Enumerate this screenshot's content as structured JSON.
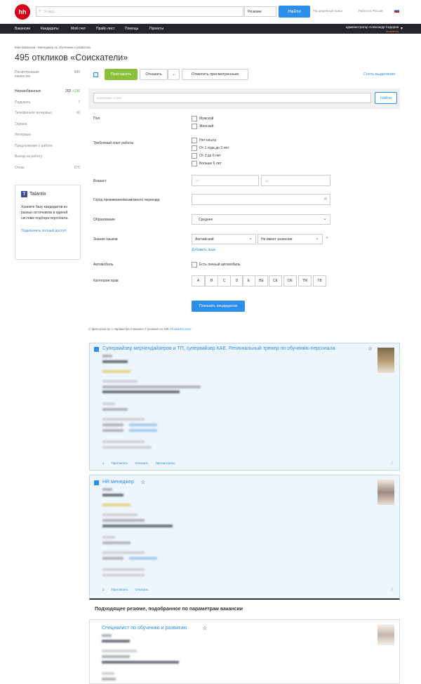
{
  "header": {
    "logo": "hh",
    "search_placeholder": "Я ищу...",
    "search_type": "Резюме",
    "find_label": "Найти",
    "advanced_search": "Расширенный поиск",
    "work_in_russia": "Работа в России"
  },
  "nav": {
    "items": [
      "Вакансии",
      "Кандидаты",
      "Мой счет",
      "Прайс-лист",
      "Помощь",
      "Проекты"
    ],
    "user": "администратор Александр Сидоров",
    "user_sub": "Компания"
  },
  "breadcrumb": "Мои вакансии › Менеджер по обучению и развитию",
  "page_title": "495 откликов «Соискатели»",
  "sidebar": {
    "items": [
      {
        "label": "Посмотревшие вакансию",
        "count": "999",
        "extra": ""
      },
      {
        "label": "Неразобранные",
        "count": "202",
        "extra": "+136"
      },
      {
        "label": "Подумать",
        "count": "7",
        "extra": ""
      },
      {
        "label": "Телефонное интервью",
        "count": "10",
        "extra": ""
      },
      {
        "label": "Оценка",
        "count": "",
        "extra": ""
      },
      {
        "label": "Интервью",
        "count": "",
        "extra": ""
      },
      {
        "label": "Предложение о работе",
        "count": "",
        "extra": ""
      },
      {
        "label": "Выход на работу",
        "count": "",
        "extra": ""
      },
      {
        "label": "Отказ",
        "count": "270",
        "extra": ""
      }
    ]
  },
  "talantix": {
    "name": "Talantix",
    "text": "Храните базу кандидатов из разных источников в единой системе подбора персонала.",
    "link": "Подключить полный доступ"
  },
  "toolbar": {
    "invite": "Пригласить",
    "reject": "Отказать",
    "mark_viewed": "Отметить просмотренным",
    "deselect": "Снять выделение"
  },
  "filters": {
    "keywords_placeholder": "Ключевые слова",
    "find": "Найти",
    "gender_label": "Пол",
    "gender": [
      "Мужской",
      "Женский"
    ],
    "exp_label": "Требуемый опыт работы",
    "exp": [
      "Нет опыта",
      "От 1 года до 3 лет",
      "От 3 до 6 лет",
      "Больше 6 лет"
    ],
    "age_label": "Возраст",
    "age_from": "от",
    "age_to": "до",
    "city_label": "Город проживания/возможного переезда",
    "edu_label": "Образование",
    "edu_value": "Среднее",
    "lang_label": "Знание языков",
    "lang_value": "Английский",
    "lang_level": "Не имеет значения",
    "add_lang": "Добавить язык",
    "car_label": "Автомобиль",
    "car_option": "Есть личный автомобиль",
    "license_label": "Категория прав",
    "licenses": [
      "A",
      "B",
      "C",
      "D",
      "E",
      "BE",
      "CE",
      "DE",
      "TM",
      "TB"
    ],
    "show": "Показать кандидатов"
  },
  "filter_summary": "С фильтром из 1 параметра показано 2 резюме из 198",
  "show_all": "Показать всех",
  "cards": [
    {
      "title": "Супервайзер мерчендайзеров и ТП, супервайзер КАЕ, Региональный тренер по обучению персонала",
      "actions": [
        "1",
        "Пригласить",
        "Отказать",
        "Просмотрено"
      ]
    },
    {
      "title": "HR менеджер",
      "actions": [
        "1",
        "Пригласить",
        "Отказать"
      ]
    }
  ],
  "recommend": {
    "heading": "Подходящее резюме, подобранное по параметрам вакансии",
    "title": "Специалист по обучению и развитию"
  }
}
